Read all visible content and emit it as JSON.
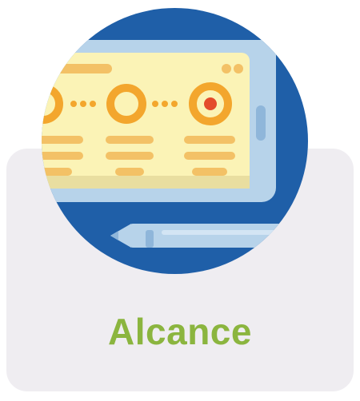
{
  "card": {
    "title": "Alcance"
  },
  "icon": {
    "name": "tablet-timeline-icon",
    "colors": {
      "circle_bg": "#1f5fa8",
      "tablet_frame": "#b7d3ea",
      "screen": "#fbf3b6",
      "accent_orange": "#f3a62d",
      "accent_red": "#e44b2b",
      "pen_body": "#b7d3ea",
      "pen_line": "#7aa6cc"
    }
  },
  "colors": {
    "title": "#8bb53f",
    "card_bg": "#efedf1"
  }
}
